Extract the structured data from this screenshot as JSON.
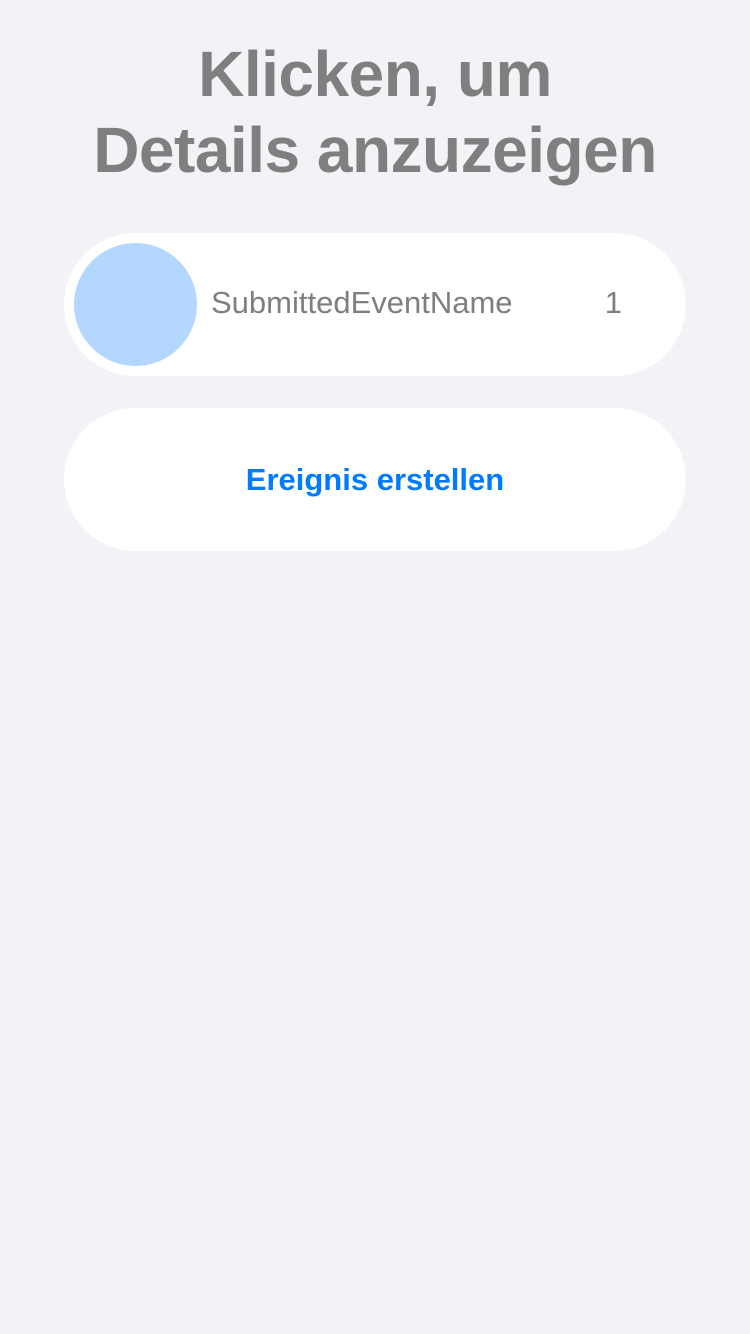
{
  "header": {
    "title": "Klicken, um\nDetails anzuzeigen"
  },
  "events": [
    {
      "name": "SubmittedEventName",
      "count": "1",
      "avatar_color": "#B3D7FF"
    }
  ],
  "actions": {
    "create_label": "Ereignis erstellen"
  },
  "colors": {
    "background": "#F2F2F7",
    "card": "#FFFFFF",
    "text_secondary": "#7F7F7F",
    "accent": "#007AFF",
    "avatar": "#B3D7FF"
  }
}
